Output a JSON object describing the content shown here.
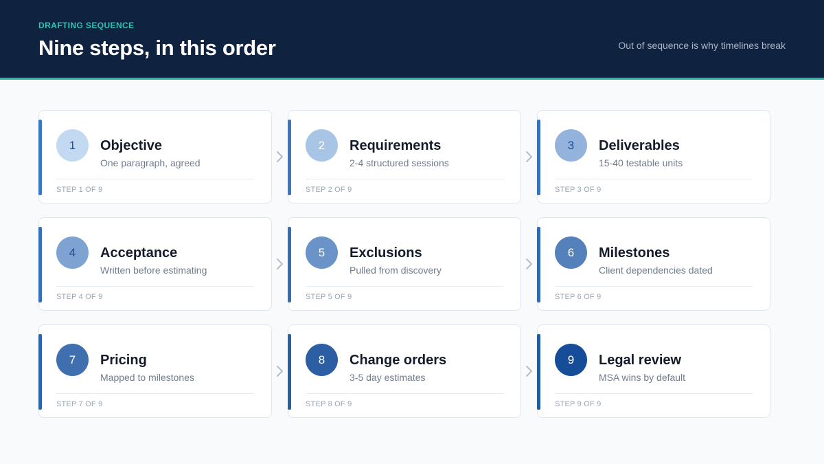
{
  "header": {
    "eyebrow": "DRAFTING SEQUENCE",
    "title": "Nine steps, in this order",
    "subtitle": "Out of sequence is why timelines break"
  },
  "colors": {
    "header_bg": "#0f223f",
    "teal_accent": "#2bb4a8",
    "step_fills": [
      "#c3d9f1",
      "#a8c5e6",
      "#93b3dc",
      "#7ea3d3",
      "#6a93c8",
      "#5581bb",
      "#3f6fae",
      "#2b5ea3",
      "#164d98"
    ],
    "step_text": [
      "#1f4c8f",
      "#ffffff",
      "#1f4c8f",
      "#1f4c8f",
      "#ffffff",
      "#ffffff",
      "#ffffff",
      "#ffffff",
      "#ffffff"
    ],
    "accent_bars": [
      "#3b78c4",
      "#3a76c1",
      "#3873bd",
      "#3670b9",
      "#346db5",
      "#3169b0",
      "#2c64aa",
      "#285fa4",
      "#225a9e"
    ]
  },
  "steps": [
    {
      "number": "1",
      "name": "Objective",
      "desc": "One paragraph, agreed",
      "step": "STEP 1 OF 9"
    },
    {
      "number": "2",
      "name": "Requirements",
      "desc": "2-4 structured sessions",
      "step": "STEP 2 OF 9"
    },
    {
      "number": "3",
      "name": "Deliverables",
      "desc": "15-40 testable units",
      "step": "STEP 3 OF 9"
    },
    {
      "number": "4",
      "name": "Acceptance",
      "desc": "Written before estimating",
      "step": "STEP 4 OF 9"
    },
    {
      "number": "5",
      "name": "Exclusions",
      "desc": "Pulled from discovery",
      "step": "STEP 5 OF 9"
    },
    {
      "number": "6",
      "name": "Milestones",
      "desc": "Client dependencies dated",
      "step": "STEP 6 OF 9"
    },
    {
      "number": "7",
      "name": "Pricing",
      "desc": "Mapped to milestones",
      "step": "STEP 7 OF 9"
    },
    {
      "number": "8",
      "name": "Change orders",
      "desc": "3-5 day estimates",
      "step": "STEP 8 OF 9"
    },
    {
      "number": "9",
      "name": "Legal review",
      "desc": "MSA wins by default",
      "step": "STEP 9 OF 9"
    }
  ],
  "arrow_icon": "chevron-right-icon"
}
